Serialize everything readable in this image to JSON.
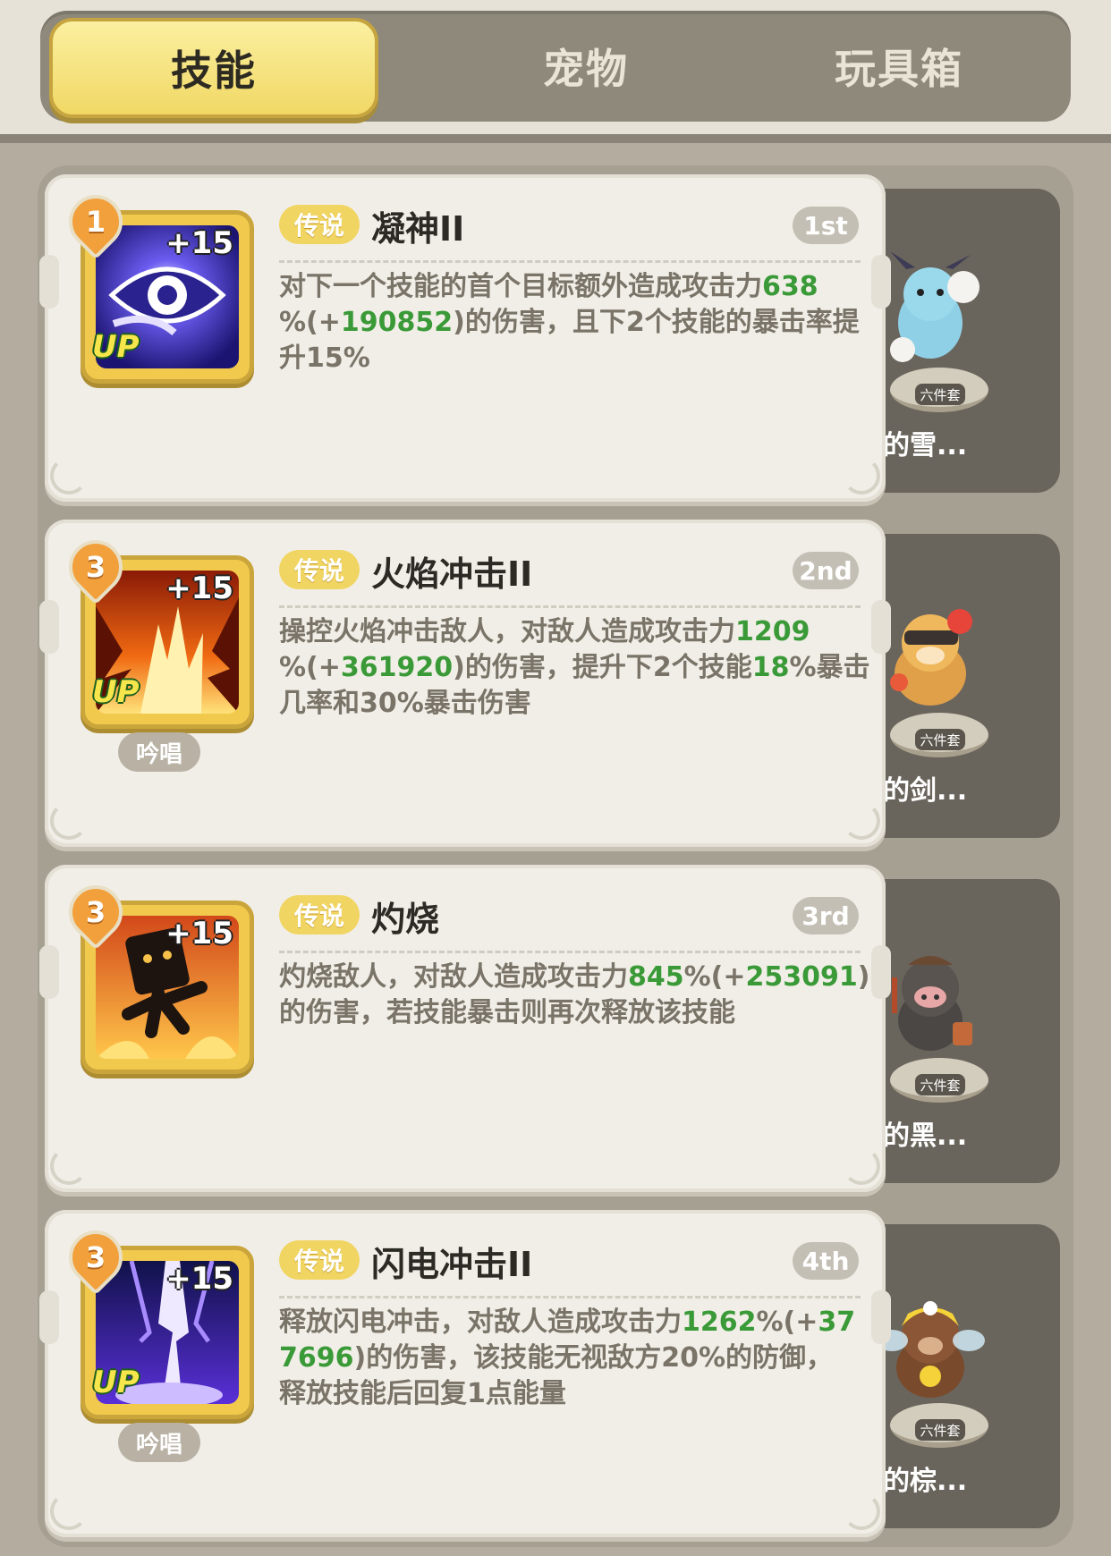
{
  "tabs": [
    {
      "label": "技能",
      "active": true
    },
    {
      "label": "宠物",
      "active": false
    },
    {
      "label": "玩具箱",
      "active": false
    }
  ],
  "skills": [
    {
      "level": "1",
      "plus": "+15",
      "up": "UP",
      "chant": "",
      "tag": "传说",
      "name": "凝神II",
      "rank": "1st",
      "desc": [
        [
          {
            "t": "对下一个技能的首个目标额外造成攻击力"
          },
          {
            "t": "638",
            "g": 1
          }
        ],
        [
          {
            "t": "%(+"
          },
          {
            "t": "190852",
            "g": 1
          },
          {
            "t": ")的伤害，且下2个技能的暴击率提"
          }
        ],
        [
          {
            "t": "升15%"
          }
        ]
      ],
      "pet": {
        "name": "快乐的雪...",
        "set": "六件套",
        "icon": "snow-bunny-pet-icon"
      },
      "icon": "eye-sigil-skill-icon"
    },
    {
      "level": "3",
      "plus": "+15",
      "up": "UP",
      "chant": "吟唱",
      "tag": "传说",
      "name": "火焰冲击II",
      "rank": "2nd",
      "desc": [
        [
          {
            "t": "操控火焰冲击敌人，对敌人造成攻击力"
          },
          {
            "t": "1209",
            "g": 1
          }
        ],
        [
          {
            "t": "%(+"
          },
          {
            "t": "361920",
            "g": 1
          },
          {
            "t": ")的伤害，提升下2个技能"
          },
          {
            "t": "18",
            "g": 1
          },
          {
            "t": "%暴击"
          }
        ],
        [
          {
            "t": "几率和30%暴击伤害"
          }
        ]
      ],
      "pet": {
        "name": "暴躁的剑...",
        "set": "六件套",
        "icon": "hamster-pet-icon"
      },
      "icon": "flame-burst-skill-icon"
    },
    {
      "level": "3",
      "plus": "+15",
      "up": "",
      "chant": "",
      "tag": "传说",
      "name": "灼烧",
      "rank": "3rd",
      "desc": [
        [
          {
            "t": "灼烧敌人，对敌人造成攻击力"
          },
          {
            "t": "845",
            "g": 1
          },
          {
            "t": "%(+"
          },
          {
            "t": "253091",
            "g": 1
          },
          {
            "t": ")"
          }
        ],
        [
          {
            "t": "的伤害，若技能暴击则再次释放该技能"
          }
        ]
      ],
      "pet": {
        "name": "活跃的黑...",
        "set": "六件套",
        "icon": "boar-pet-icon"
      },
      "icon": "burning-figure-skill-icon"
    },
    {
      "level": "3",
      "plus": "+15",
      "up": "UP",
      "chant": "吟唱",
      "tag": "传说",
      "name": "闪电冲击II",
      "rank": "4th",
      "desc": [
        [
          {
            "t": "释放闪电冲击，对敌人造成攻击力"
          },
          {
            "t": "1262",
            "g": 1
          },
          {
            "t": "%(+"
          },
          {
            "t": "37",
            "g": 1
          }
        ],
        [
          {
            "t": "7696",
            "g": 1
          },
          {
            "t": ")的伤害，该技能无视敌方20%的防御，"
          }
        ],
        [
          {
            "t": "释放技能后回复1点能量"
          }
        ]
      ],
      "pet": {
        "name": "贪吃的棕...",
        "set": "六件套",
        "icon": "bee-bear-pet-icon"
      },
      "icon": "lightning-strike-skill-icon"
    }
  ],
  "colors": {
    "highlight": "#3a9a37",
    "tag": "#f1d562",
    "active_tab": "#f1d865"
  }
}
